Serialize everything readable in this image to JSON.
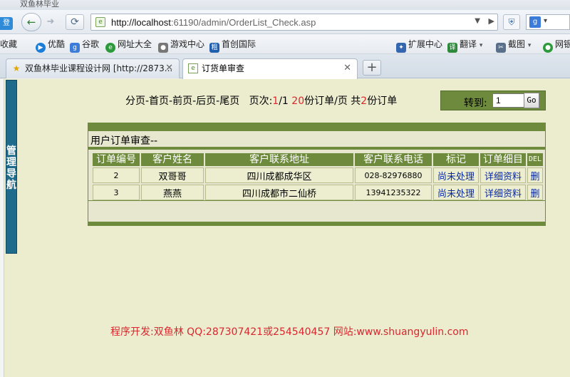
{
  "browser": {
    "title_fragment": "双鱼林毕业",
    "login_tag": "登录",
    "url_host": "http://localhost",
    "url_rest": ":61190/admin/OrderList_Check.asp",
    "search_engine": "g"
  },
  "bookmarks": {
    "left": [
      {
        "label": "收藏",
        "icon": "favorites-icon"
      },
      {
        "label": "优酷",
        "icon": "youku-icon",
        "color": "#1a7dd8"
      },
      {
        "label": "谷歌",
        "icon": "google-icon",
        "color": "#3b7bd9"
      },
      {
        "label": "网址大全",
        "icon": "sites-icon",
        "color": "#2c9a3a"
      },
      {
        "label": "游戏中心",
        "icon": "gamepad-icon",
        "color": "#777777"
      },
      {
        "label": "首创国际",
        "icon": "shouchuang-icon",
        "color": "#1f5fae"
      }
    ],
    "right": [
      {
        "label": "扩展中心",
        "icon": "puzzle-icon"
      },
      {
        "label": "翻译",
        "icon": "translate-icon"
      },
      {
        "label": "截图",
        "icon": "scissors-icon"
      },
      {
        "label": "网银",
        "icon": "bank-icon"
      }
    ]
  },
  "tabs": [
    {
      "label": "双鱼林毕业课程设计网 [http://2873...",
      "icon": "star-icon"
    },
    {
      "label": "订货单审查",
      "icon": "page-icon"
    }
  ],
  "nav_panel": {
    "label": "管理导航"
  },
  "pager": {
    "nav_links": "分页-首页-前页-后页-尾页",
    "page_label": "页次:",
    "page_current": "1",
    "page_total": "/1",
    "per_page": "20",
    "per_page_label": "份订单/页",
    "total_label": "共",
    "total_count": "2",
    "total_unit": "份订单"
  },
  "goto": {
    "label": "转到:",
    "value": "1",
    "button": "Go"
  },
  "panel": {
    "title": "用户订单审查--",
    "columns": [
      "订单编号",
      "客户姓名",
      "客户联系地址",
      "客户联系电话",
      "标记",
      "订单细目",
      "DEL"
    ],
    "rows": [
      {
        "id": "2",
        "name": "双哥哥",
        "address": "四川成都成华区",
        "phone": "028-82976880",
        "mark": "尚未处理",
        "detail": "详细资料",
        "del": "删"
      },
      {
        "id": "3",
        "name": "燕燕",
        "address": "四川成都市二仙桥",
        "phone": "13941235322",
        "mark": "尚未处理",
        "detail": "详细资料",
        "del": "删"
      }
    ]
  },
  "footer": "程序开发:双鱼林 QQ:287307421或254540457 网站:www.shuangyulin.com",
  "colors": {
    "accent_green": "#6e8b3d",
    "nav_blue": "#1e6b8c",
    "highlight_red": "#d9272e",
    "link_blue": "#0b2a9e"
  }
}
